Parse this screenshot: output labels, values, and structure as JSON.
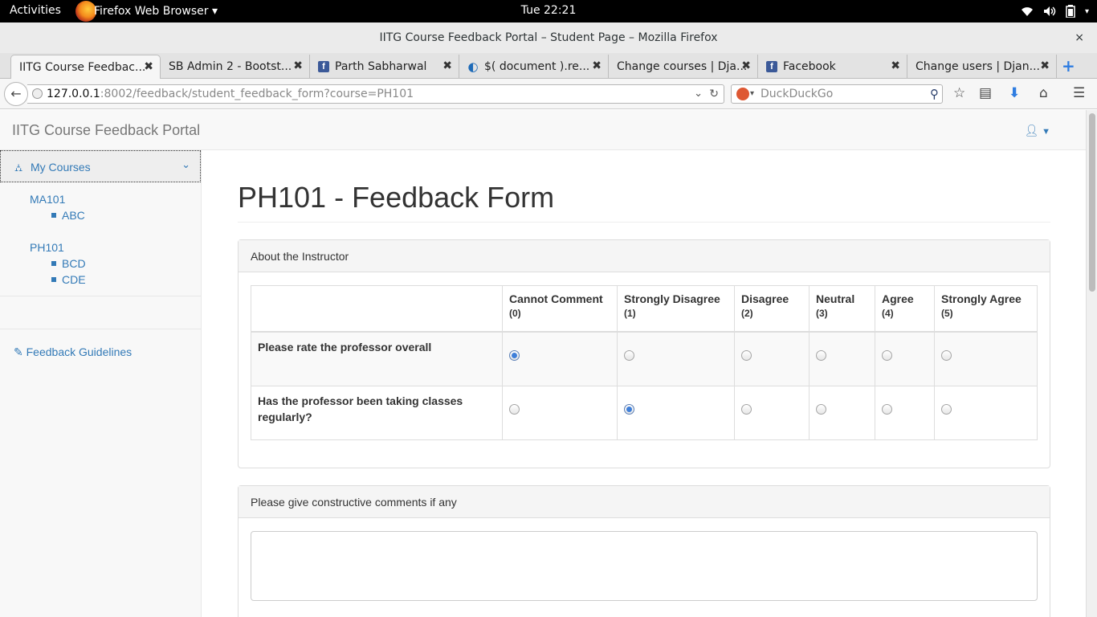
{
  "topbar": {
    "activities": "Activities",
    "app": "Firefox Web Browser ▾",
    "clock": "Tue 22:21"
  },
  "window": {
    "title": "IITG Course Feedback Portal – Student Page – Mozilla Firefox",
    "close": "×"
  },
  "tabs": [
    {
      "label": "IITG Course Feedbac...",
      "favicon": "none"
    },
    {
      "label": "SB Admin 2 - Bootst...",
      "favicon": "none"
    },
    {
      "label": "Parth Sabharwal",
      "favicon": "facebook-icon"
    },
    {
      "label": "$( document ).re...",
      "favicon": "jquery-icon"
    },
    {
      "label": "Change courses | Dja...",
      "favicon": "none"
    },
    {
      "label": "Facebook",
      "favicon": "facebook-icon"
    },
    {
      "label": "Change users | Djan...",
      "favicon": "none"
    }
  ],
  "url": {
    "host": "127.0.0.1",
    "rest": ":8002/feedback/student_feedback_form?course=PH101"
  },
  "search": {
    "placeholder": "DuckDuckGo"
  },
  "page": {
    "brand": "IITG Course Feedback Portal",
    "sidebar": {
      "header": "My Courses",
      "courses": [
        {
          "code": "MA101",
          "subs": [
            "ABC"
          ]
        },
        {
          "code": "PH101",
          "subs": [
            "BCD",
            "CDE"
          ]
        }
      ],
      "guidelines": "Feedback Guidelines"
    },
    "title": "PH101 - Feedback Form",
    "instructor_panel": {
      "heading": "About the Instructor",
      "columns": [
        {
          "label": "Cannot Comment",
          "value": "(0)"
        },
        {
          "label": "Strongly Disagree",
          "value": "(1)"
        },
        {
          "label": "Disagree",
          "value": "(2)"
        },
        {
          "label": "Neutral",
          "value": "(3)"
        },
        {
          "label": "Agree",
          "value": "(4)"
        },
        {
          "label": "Strongly Agree",
          "value": "(5)"
        }
      ],
      "questions": [
        {
          "text": "Please rate the professor overall",
          "selected": 0
        },
        {
          "text": "Has the professor been taking classes regularly?",
          "selected": 1
        }
      ]
    },
    "comments_panel": {
      "heading": "Please give constructive comments if any",
      "value": ""
    }
  }
}
